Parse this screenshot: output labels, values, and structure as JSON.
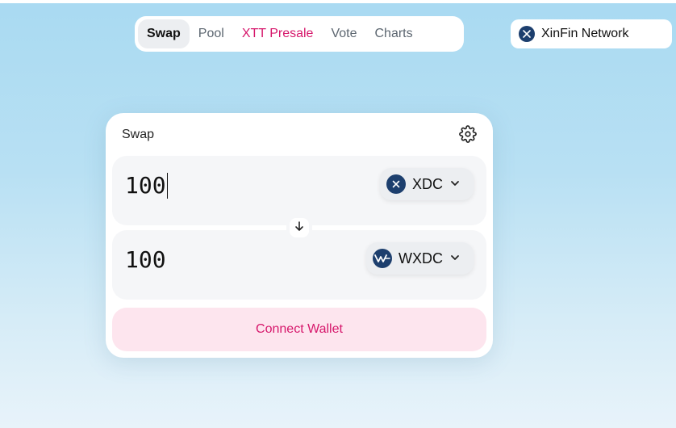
{
  "nav": {
    "items": [
      {
        "label": "Swap",
        "active": true
      },
      {
        "label": "Pool"
      },
      {
        "label": "XTT Presale",
        "highlight": true
      },
      {
        "label": "Vote"
      },
      {
        "label": "Charts"
      }
    ]
  },
  "network": {
    "label": "XinFin Network",
    "icon": "xdc-network-icon"
  },
  "swap": {
    "title": "Swap",
    "settings_icon": "gear-icon",
    "input": {
      "amount": "100",
      "token": "XDC",
      "token_icon": "xdc-token-icon"
    },
    "output": {
      "amount": "100",
      "token": "WXDC",
      "token_icon": "wxdc-token-icon"
    },
    "switch_icon": "arrow-down-icon",
    "connect_label": "Connect Wallet"
  },
  "colors": {
    "accent": "#d6176b",
    "connect_bg": "#fde5ee",
    "token_brand": "#1d3f6e"
  }
}
